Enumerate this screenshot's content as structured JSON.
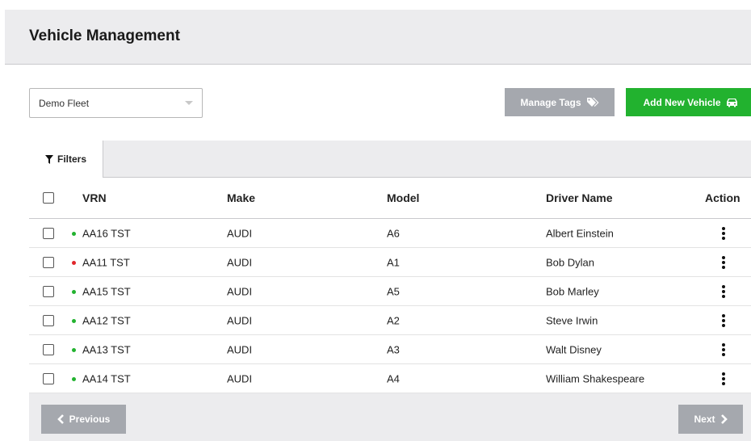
{
  "page": {
    "title": "Vehicle Management"
  },
  "fleet_select": {
    "value": "Demo Fleet"
  },
  "buttons": {
    "manage_tags": "Manage Tags",
    "add_vehicle": "Add New Vehicle",
    "previous": "Previous",
    "next": "Next"
  },
  "filters": {
    "label": "Filters"
  },
  "table": {
    "headers": {
      "vrn": "VRN",
      "make": "Make",
      "model": "Model",
      "driver": "Driver Name",
      "action": "Action"
    },
    "rows": [
      {
        "vrn": "AA16 TST",
        "status_color": "#22b22f",
        "make": "AUDI",
        "model": "A6",
        "driver": "Albert Einstein"
      },
      {
        "vrn": "AA11 TST",
        "status_color": "#e0262b",
        "make": "AUDI",
        "model": "A1",
        "driver": "Bob Dylan"
      },
      {
        "vrn": "AA15 TST",
        "status_color": "#22b22f",
        "make": "AUDI",
        "model": "A5",
        "driver": "Bob Marley"
      },
      {
        "vrn": "AA12 TST",
        "status_color": "#22b22f",
        "make": "AUDI",
        "model": "A2",
        "driver": "Steve Irwin"
      },
      {
        "vrn": "AA13 TST",
        "status_color": "#22b22f",
        "make": "AUDI",
        "model": "A3",
        "driver": "Walt Disney"
      },
      {
        "vrn": "AA14 TST",
        "status_color": "#22b22f",
        "make": "AUDI",
        "model": "A4",
        "driver": "William Shakespeare"
      }
    ]
  },
  "colors": {
    "accent_green": "#22b22f",
    "button_grey": "#a5a8ae",
    "status_ok": "#22b22f",
    "status_alert": "#e0262b"
  },
  "icons": {
    "tags": "tags-icon",
    "car": "car-icon",
    "filter": "filter-icon",
    "chevron_left": "chevron-left-icon",
    "chevron_right": "chevron-right-icon",
    "kebab": "kebab-menu-icon",
    "dropdown": "chevron-down-icon"
  }
}
